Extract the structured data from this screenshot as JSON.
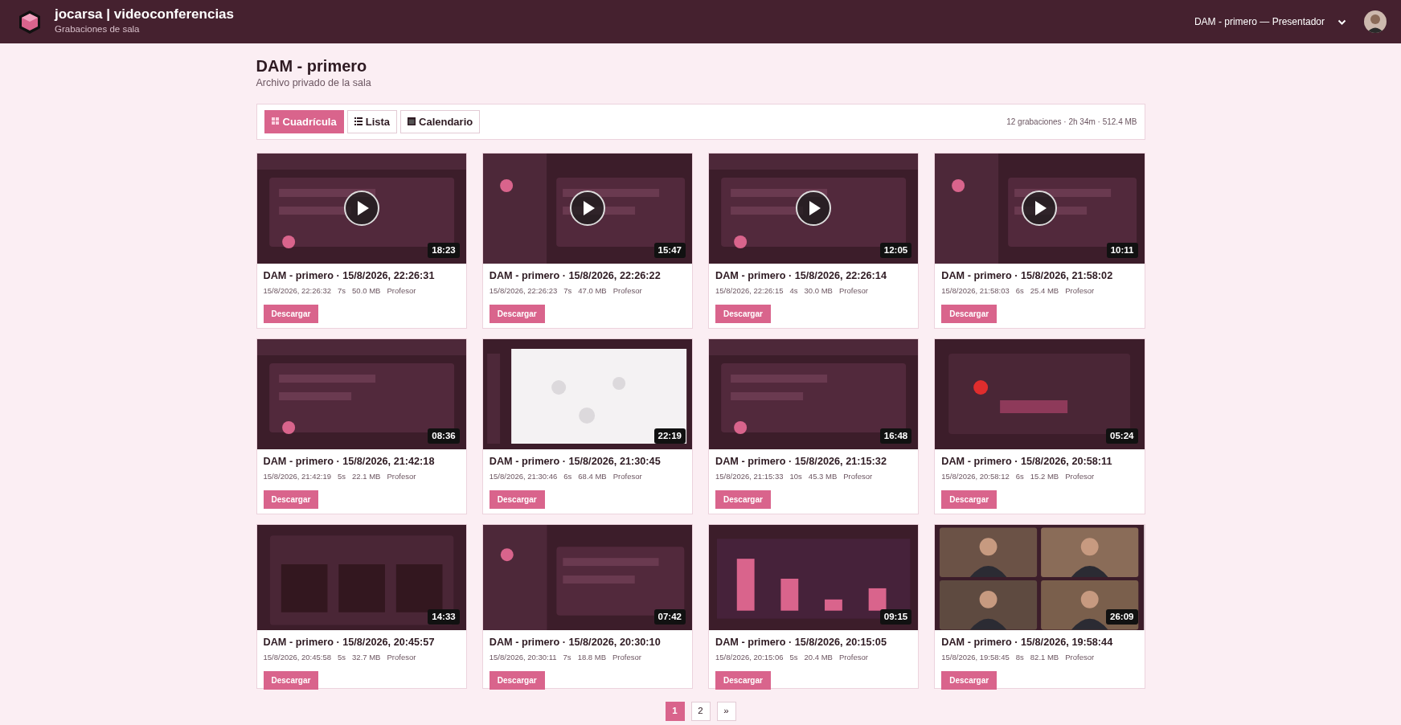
{
  "header": {
    "title": "jocarsa | videoconferencias",
    "subtitle": "Grabaciones de sala",
    "room_menu": "DAM - primero — Presentador"
  },
  "page": {
    "title": "DAM - primero",
    "subtitle": "Archivo privado de la sala"
  },
  "views": [
    {
      "label": "Cuadrícula",
      "selected": true
    },
    {
      "label": "Lista",
      "selected": false
    },
    {
      "label": "Calendario",
      "selected": false
    }
  ],
  "summary": "12 grabaciones · 2h 34m · 512.4 MB",
  "recordings": [
    {
      "title": "DAM - primero · 15/8/2026, 22:26:31",
      "date": "15/8/2026, 22:26:32",
      "duration": "7s",
      "size": "50.0 MB",
      "role": "Profesor",
      "length": "18:23",
      "play_overlay": true,
      "download": "Descargar"
    },
    {
      "title": "DAM - primero · 15/8/2026, 22:26:22",
      "date": "15/8/2026, 22:26:23",
      "duration": "7s",
      "size": "47.0 MB",
      "role": "Profesor",
      "length": "15:47",
      "play_overlay": true,
      "download": "Descargar"
    },
    {
      "title": "DAM - primero · 15/8/2026, 22:26:14",
      "date": "15/8/2026, 22:26:15",
      "duration": "4s",
      "size": "30.0 MB",
      "role": "Profesor",
      "length": "12:05",
      "play_overlay": true,
      "download": "Descargar"
    },
    {
      "title": "DAM - primero · 15/8/2026, 21:58:02",
      "date": "15/8/2026, 21:58:03",
      "duration": "6s",
      "size": "25.4 MB",
      "role": "Profesor",
      "length": "10:11",
      "play_overlay": true,
      "download": "Descargar"
    },
    {
      "title": "DAM - primero · 15/8/2026, 21:42:18",
      "date": "15/8/2026, 21:42:19",
      "duration": "5s",
      "size": "22.1 MB",
      "role": "Profesor",
      "length": "08:36",
      "play_overlay": false,
      "download": "Descargar"
    },
    {
      "title": "DAM - primero · 15/8/2026, 21:30:45",
      "date": "15/8/2026, 21:30:46",
      "duration": "6s",
      "size": "68.4 MB",
      "role": "Profesor",
      "length": "22:19",
      "play_overlay": false,
      "download": "Descargar"
    },
    {
      "title": "DAM - primero · 15/8/2026, 21:15:32",
      "date": "15/8/2026, 21:15:33",
      "duration": "10s",
      "size": "45.3 MB",
      "role": "Profesor",
      "length": "16:48",
      "play_overlay": false,
      "download": "Descargar"
    },
    {
      "title": "DAM - primero · 15/8/2026, 20:58:11",
      "date": "15/8/2026, 20:58:12",
      "duration": "6s",
      "size": "15.2 MB",
      "role": "Profesor",
      "length": "05:24",
      "play_overlay": false,
      "download": "Descargar"
    },
    {
      "title": "DAM - primero · 15/8/2026, 20:45:57",
      "date": "15/8/2026, 20:45:58",
      "duration": "5s",
      "size": "32.7 MB",
      "role": "Profesor",
      "length": "14:33",
      "play_overlay": false,
      "download": "Descargar"
    },
    {
      "title": "DAM - primero · 15/8/2026, 20:30:10",
      "date": "15/8/2026, 20:30:11",
      "duration": "7s",
      "size": "18.8 MB",
      "role": "Profesor",
      "length": "07:42",
      "play_overlay": false,
      "download": "Descargar"
    },
    {
      "title": "DAM - primero · 15/8/2026, 20:15:05",
      "date": "15/8/2026, 20:15:06",
      "duration": "5s",
      "size": "20.4 MB",
      "role": "Profesor",
      "length": "09:15",
      "play_overlay": false,
      "download": "Descargar"
    },
    {
      "title": "DAM - primero · 15/8/2026, 19:58:44",
      "date": "15/8/2026, 19:58:45",
      "duration": "8s",
      "size": "82.1 MB",
      "role": "Profesor",
      "length": "26:09",
      "play_overlay": false,
      "download": "Descargar"
    }
  ],
  "pagination": [
    {
      "label": "1",
      "selected": true
    },
    {
      "label": "2",
      "selected": false
    },
    {
      "label": "»",
      "selected": false
    }
  ]
}
